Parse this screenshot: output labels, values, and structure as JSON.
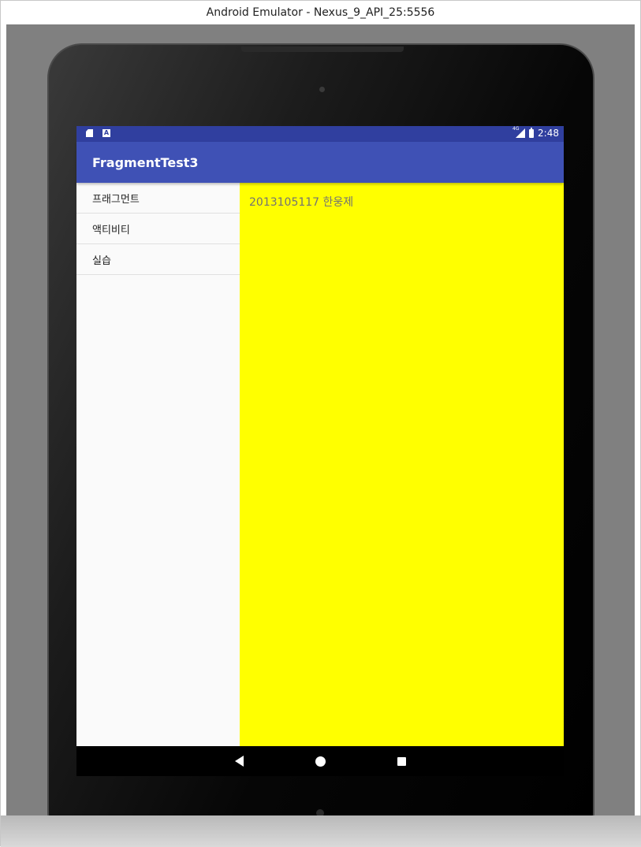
{
  "window": {
    "title": "Android Emulator - Nexus_9_API_25:5556"
  },
  "status_bar": {
    "left_icons": [
      "sd-card-icon",
      "a-notification-icon"
    ],
    "a_icon_glyph": "A",
    "network_label": "4G",
    "time": "2:48"
  },
  "app_bar": {
    "title": "FragmentTest3",
    "color": "#3f51b5"
  },
  "list": {
    "items": [
      {
        "label": "프래그먼트"
      },
      {
        "label": "액티비티"
      },
      {
        "label": "실습"
      }
    ]
  },
  "detail": {
    "text": "2013105117 한웅제",
    "background": "#ffff00"
  },
  "nav_bar": {
    "buttons": [
      "back-icon",
      "home-icon",
      "recents-icon"
    ]
  },
  "colors": {
    "status_bar": "#303f9f",
    "app_bar": "#3f51b5",
    "detail_bg": "#ffff00"
  }
}
